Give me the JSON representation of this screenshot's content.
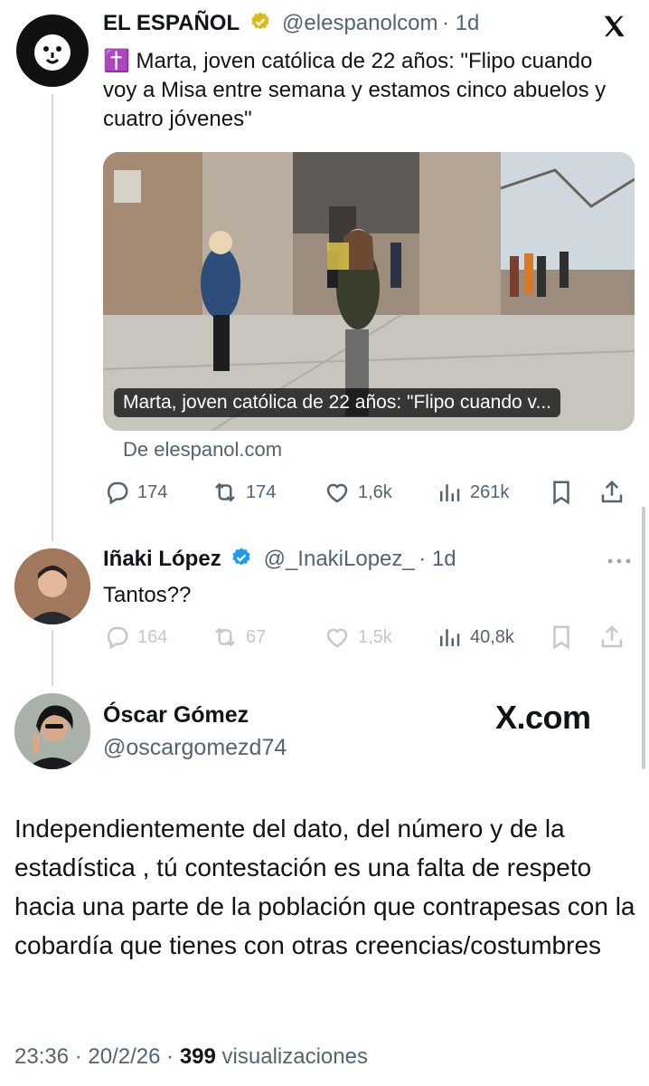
{
  "tweet1": {
    "author_name": "EL ESPAÑOL",
    "handle": "@elespanolcom",
    "age": "1d",
    "text": "✝️ Marta, joven católica de 22 años: \"Flipo cuando voy a Misa entre semana y estamos cinco abuelos y cuatro jóvenes\"",
    "card_caption": "Marta, joven católica de 22 años: \"Flipo cuando v...",
    "card_source": "De elespanol.com",
    "replies": "174",
    "reposts": "174",
    "likes": "1,6k",
    "views": "261k",
    "verified_color": "#e2b719"
  },
  "tweet2": {
    "author_name": "Iñaki López",
    "handle": "@_InakiLopez_",
    "age": "1d",
    "text": "Tantos??",
    "replies": "164",
    "reposts": "67",
    "likes": "1,5k",
    "views": "40,8k",
    "verified_color": "#1d9bf0"
  },
  "tweet3": {
    "author_name": "Óscar Gómez",
    "handle": "@oscargomezd74",
    "watermark": "X.com",
    "text": "Independientemente del dato, del número y de la estadística , tú contestación es una falta de respeto hacia una parte de la población que contrapesas con la cobardía que tienes con otras creencias/costumbres",
    "time": "23:36",
    "date": "20/2/26",
    "views_count": "399",
    "views_label": "visualizaciones"
  },
  "icons": [
    "x-logo-icon",
    "verified-badge-icon",
    "reply-icon",
    "repost-icon",
    "like-icon",
    "views-icon",
    "bookmark-icon",
    "share-icon",
    "more-icon"
  ]
}
